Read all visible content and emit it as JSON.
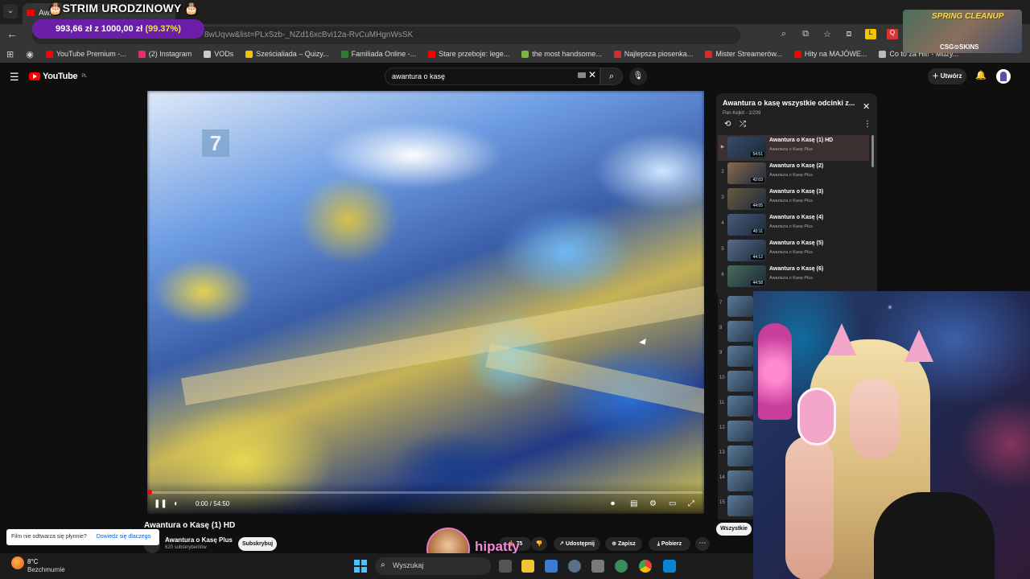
{
  "browser": {
    "tab_title": "Aw...",
    "url_fragment": "8wUqvw&list=PLxSzb-_NZd16xcBvi12a-RvCuMHgnWsSK",
    "bookmarks": [
      {
        "label": "YouTube Premium -...",
        "color": "#ff0000"
      },
      {
        "label": "(2) Instagram",
        "color": "#e1306c"
      },
      {
        "label": "VODs",
        "color": "#cccccc"
      },
      {
        "label": "Sześcialiada – Quizy...",
        "color": "#f5c400"
      },
      {
        "label": "Familiada Online -...",
        "color": "#2e7d32"
      },
      {
        "label": "Stare przeboje: lege...",
        "color": "#ff0000"
      },
      {
        "label": "the most handsome...",
        "color": "#7cb342"
      },
      {
        "label": "Najlepsza piosenka...",
        "color": "#d32f2f"
      },
      {
        "label": "Mister Streamerów...",
        "color": "#d32f2f"
      },
      {
        "label": "Hity na MAJÓWE...",
        "color": "#ff0000"
      },
      {
        "label": "Co to za Hit! - Muzy...",
        "color": "#bbbbbb"
      }
    ]
  },
  "overlay": {
    "goal_title": "🎂STRIM URODZINOWY 🎂",
    "goal_amount": "993,66 zł z 1000,00 zł",
    "goal_percent": "(99.37%)",
    "promo_title": "SPRING CLEANUP",
    "promo_sub": "CSG⊙SKINS",
    "streamer_name": "hipatty"
  },
  "youtube": {
    "logo_text": "YouTube",
    "logo_region": "PL",
    "search_value": "awantura o kasę",
    "create_label": "Utwórz",
    "video": {
      "title": "Awantura o Kasę (1) HD",
      "time": "0:00 / 54:50",
      "progress": 0,
      "channel_name": "Awantura o Kasę Plus",
      "channel_subs": "620 subskrybentów",
      "subscribe_label": "Subskrybuj",
      "like_count": "75",
      "share_label": "Udostępnij",
      "save_label": "Zapisz",
      "download_label": "Pobierz"
    },
    "toast": {
      "text": "Film nie odtwarza się płynnie?",
      "link": "Dowiedz się dlaczego"
    },
    "playlist": {
      "title": "Awantura o kasę wszystkie odcinki z...",
      "meta": "Pan Kejkit - 1/209",
      "all_label": "Wszystkie",
      "items": [
        {
          "idx": "▶",
          "title": "Awantura o Kasę (1) HD",
          "channel": "Awantura o Kasę Plus",
          "duration": "54:51"
        },
        {
          "idx": "2",
          "title": "Awantura o Kasę (2)",
          "channel": "Awantura o Kasę Plus",
          "duration": "42:03"
        },
        {
          "idx": "3",
          "title": "Awantura o Kasę (3)",
          "channel": "Awantura o Kasę Plus",
          "duration": "44:05"
        },
        {
          "idx": "4",
          "title": "Awantura o Kasę (4)",
          "channel": "Awantura o Kasę Plus",
          "duration": "40:11"
        },
        {
          "idx": "5",
          "title": "Awantura o Kasę (5)",
          "channel": "Awantura o Kasę Plus",
          "duration": "44:12"
        },
        {
          "idx": "6",
          "title": "Awantura o Kasę (6)",
          "channel": "Awantura o Kasę Plus",
          "duration": "44:58"
        }
      ],
      "more_indices": [
        "7",
        "8",
        "9",
        "10",
        "11",
        "12",
        "13",
        "14",
        "15"
      ]
    }
  },
  "taskbar": {
    "temp": "8°C",
    "weather": "Bezchmurnie",
    "search_label": "Wyszukaj"
  },
  "colors": {
    "yt_bg": "#0f0f0f",
    "accent_red": "#ff0000",
    "goal_purple": "#6b1fa8",
    "streamer_pink": "#f28ad8"
  }
}
